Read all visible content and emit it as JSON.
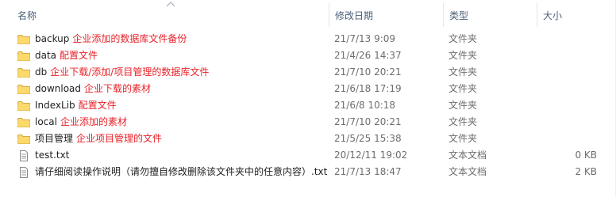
{
  "columns": {
    "name": "名称",
    "modified": "修改日期",
    "type": "类型",
    "size": "大小"
  },
  "rows": [
    {
      "name": "backup",
      "note": "企业添加的数据库文件备份",
      "modified": "21/7/13 9:09",
      "type": "文件夹",
      "size": "",
      "icon": "folder-icon"
    },
    {
      "name": "data",
      "note": "配置文件",
      "modified": "21/4/26 14:37",
      "type": "文件夹",
      "size": "",
      "icon": "folder-icon"
    },
    {
      "name": "db",
      "note": "企业下载/添加/项目管理的数据库文件",
      "modified": "21/7/10 20:21",
      "type": "文件夹",
      "size": "",
      "icon": "folder-icon"
    },
    {
      "name": "download",
      "note": "企业下载的素材",
      "modified": "21/6/18 17:19",
      "type": "文件夹",
      "size": "",
      "icon": "folder-icon"
    },
    {
      "name": "IndexLib",
      "note": "配置文件",
      "modified": "21/6/8 10:18",
      "type": "文件夹",
      "size": "",
      "icon": "folder-icon"
    },
    {
      "name": "local",
      "note": "企业添加的素材",
      "modified": "21/7/10 20:21",
      "type": "文件夹",
      "size": "",
      "icon": "folder-icon"
    },
    {
      "name": "项目管理",
      "note": "企业项目管理的文件",
      "modified": "21/5/25 15:38",
      "type": "文件夹",
      "size": "",
      "icon": "folder-icon"
    },
    {
      "name": "test.txt",
      "note": "",
      "modified": "20/12/11 19:02",
      "type": "文本文档",
      "size": "0 KB",
      "icon": "text-file-icon"
    },
    {
      "name": "请仔细阅读操作说明（请勿擅自修改删除该文件夹中的任意内容）.txt",
      "note": "",
      "modified": "21/7/13 18:47",
      "type": "文本文档",
      "size": "2 KB",
      "icon": "text-file-icon"
    }
  ],
  "colors": {
    "note": "#e8222a",
    "folder": "#f8d775",
    "header_text": "#4c607a"
  }
}
